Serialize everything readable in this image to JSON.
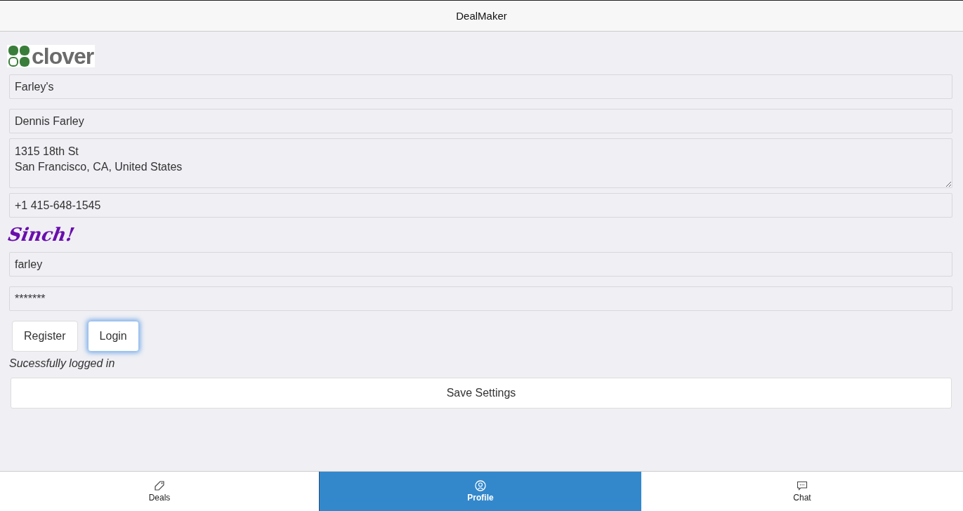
{
  "header": {
    "title": "DealMaker"
  },
  "clover": {
    "logo_text": "clover",
    "fields": [
      {
        "kind": "input",
        "value": "Farley's"
      },
      {
        "kind": "input",
        "value": "Dennis Farley"
      },
      {
        "kind": "textarea",
        "value": "1315 18th St\nSan Francisco, CA, United States"
      },
      {
        "kind": "input",
        "value": "+1 415-648-1545"
      }
    ]
  },
  "sinch": {
    "logo_text": "Sinch!",
    "fields": [
      {
        "kind": "input",
        "value": "farley"
      },
      {
        "kind": "input",
        "value": "*******"
      }
    ],
    "buttons": [
      {
        "label": "Register",
        "focused": false
      },
      {
        "label": "Login",
        "focused": true
      }
    ],
    "status": "Sucessfully logged in"
  },
  "save_button": "Save Settings",
  "tabs": [
    {
      "kind": "tag",
      "label": "Deals",
      "selected": false
    },
    {
      "kind": "profile",
      "label": "Profile",
      "selected": true
    },
    {
      "kind": "chat",
      "label": "Chat",
      "selected": false
    }
  ]
}
